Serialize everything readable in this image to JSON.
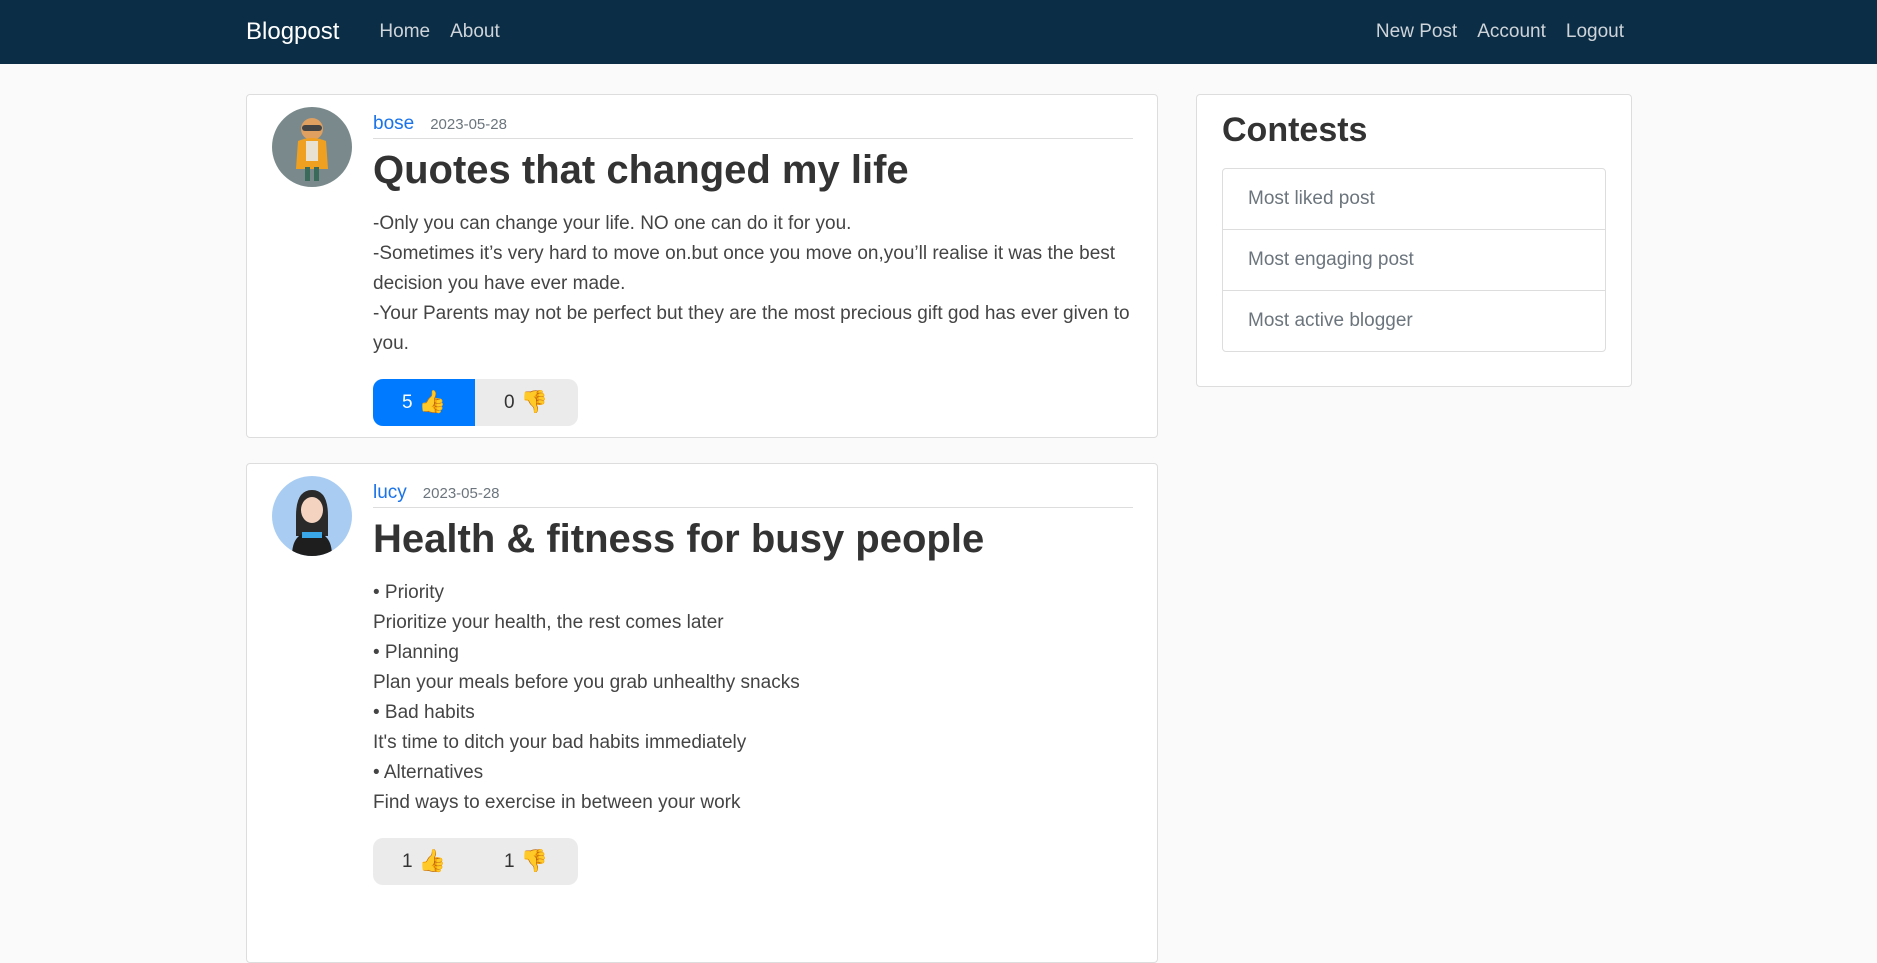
{
  "nav": {
    "brand": "Blogpost",
    "left": [
      "Home",
      "About"
    ],
    "right": [
      "New Post",
      "Account",
      "Logout"
    ]
  },
  "posts": [
    {
      "author": "bose",
      "date": "2023-05-28",
      "title": "Quotes that changed my life",
      "content": [
        "-Only you can change your life. NO one can do it for you.",
        "-Sometimes it’s very hard to move on.but once you move on,you’ll realise it was the best decision you have ever made.",
        "-Your Parents may not be perfect but they are the most precious gift god has ever given to you."
      ],
      "likes": "5",
      "dislikes": "0",
      "liked": true
    },
    {
      "author": "lucy",
      "date": "2023-05-28",
      "title": "Health & fitness for busy people",
      "content": [
        "• Priority",
        "Prioritize your health, the rest comes later",
        "• Planning",
        "Plan your meals before you grab unhealthy snacks",
        "• Bad habits",
        "It's time to ditch your bad habits immediately",
        "• Alternatives",
        "Find ways to exercise in between your work"
      ],
      "likes": "1",
      "dislikes": "1",
      "liked": false
    }
  ],
  "sidebar": {
    "title": "Contests",
    "items": [
      "Most liked post",
      "Most engaging post",
      "Most active blogger"
    ]
  },
  "icons": {
    "like": "thumbs-up-icon",
    "dislike": "thumbs-down-icon"
  },
  "colors": {
    "navbar": "#0b2d45",
    "accent": "#007bff",
    "link": "#1a73e8"
  }
}
